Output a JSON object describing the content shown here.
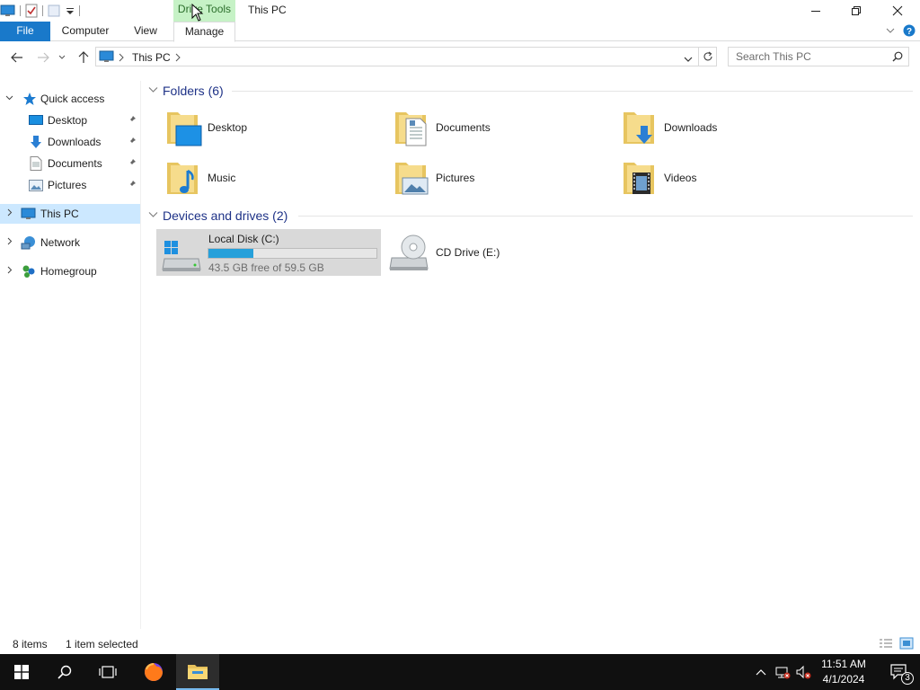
{
  "titlebar": {
    "context_tab_group": "Drive Tools",
    "window_title": "This PC",
    "minimize": "minimize",
    "restore": "restore",
    "close": "close"
  },
  "ribbon": {
    "tabs": [
      {
        "label": "File"
      },
      {
        "label": "Computer"
      },
      {
        "label": "View"
      },
      {
        "label": "Manage"
      }
    ]
  },
  "address": {
    "path": [
      "This PC"
    ],
    "search_placeholder": "Search This PC"
  },
  "navpane": {
    "items": [
      {
        "label": "Quick access",
        "icon": "star-icon"
      },
      {
        "label": "Desktop",
        "icon": "desktop-icon",
        "pinned": true
      },
      {
        "label": "Downloads",
        "icon": "download-arrow-icon",
        "pinned": true
      },
      {
        "label": "Documents",
        "icon": "document-icon",
        "pinned": true
      },
      {
        "label": "Pictures",
        "icon": "picture-icon",
        "pinned": true
      },
      {
        "label": "This PC",
        "icon": "computer-icon",
        "selected": true
      },
      {
        "label": "Network",
        "icon": "network-icon"
      },
      {
        "label": "Homegroup",
        "icon": "homegroup-icon"
      }
    ]
  },
  "content": {
    "folders_header": "Folders (6)",
    "folders": [
      {
        "label": "Desktop",
        "icon": "folder-desktop-icon"
      },
      {
        "label": "Documents",
        "icon": "folder-documents-icon"
      },
      {
        "label": "Downloads",
        "icon": "folder-downloads-icon"
      },
      {
        "label": "Music",
        "icon": "folder-music-icon"
      },
      {
        "label": "Pictures",
        "icon": "folder-pictures-icon"
      },
      {
        "label": "Videos",
        "icon": "folder-videos-icon"
      }
    ],
    "drives_header": "Devices and drives (2)",
    "drives": [
      {
        "label": "Local Disk (C:)",
        "free_text": "43.5 GB free of 59.5 GB",
        "used_fraction": 0.269,
        "selected": true,
        "icon": "hard-drive-icon"
      },
      {
        "label": "CD Drive (E:)",
        "icon": "cd-drive-icon"
      }
    ]
  },
  "status": {
    "items_count": "8 items",
    "selection": "1 item selected"
  },
  "taskbar": {
    "time": "11:51 AM",
    "date": "4/1/2024",
    "notification_count": "3"
  },
  "colors": {
    "accent": "#1979ca",
    "selection": "#cce8ff",
    "context_tab": "#c6f2c6",
    "drive_bar": "#26a0da",
    "taskbar": "#101010"
  }
}
